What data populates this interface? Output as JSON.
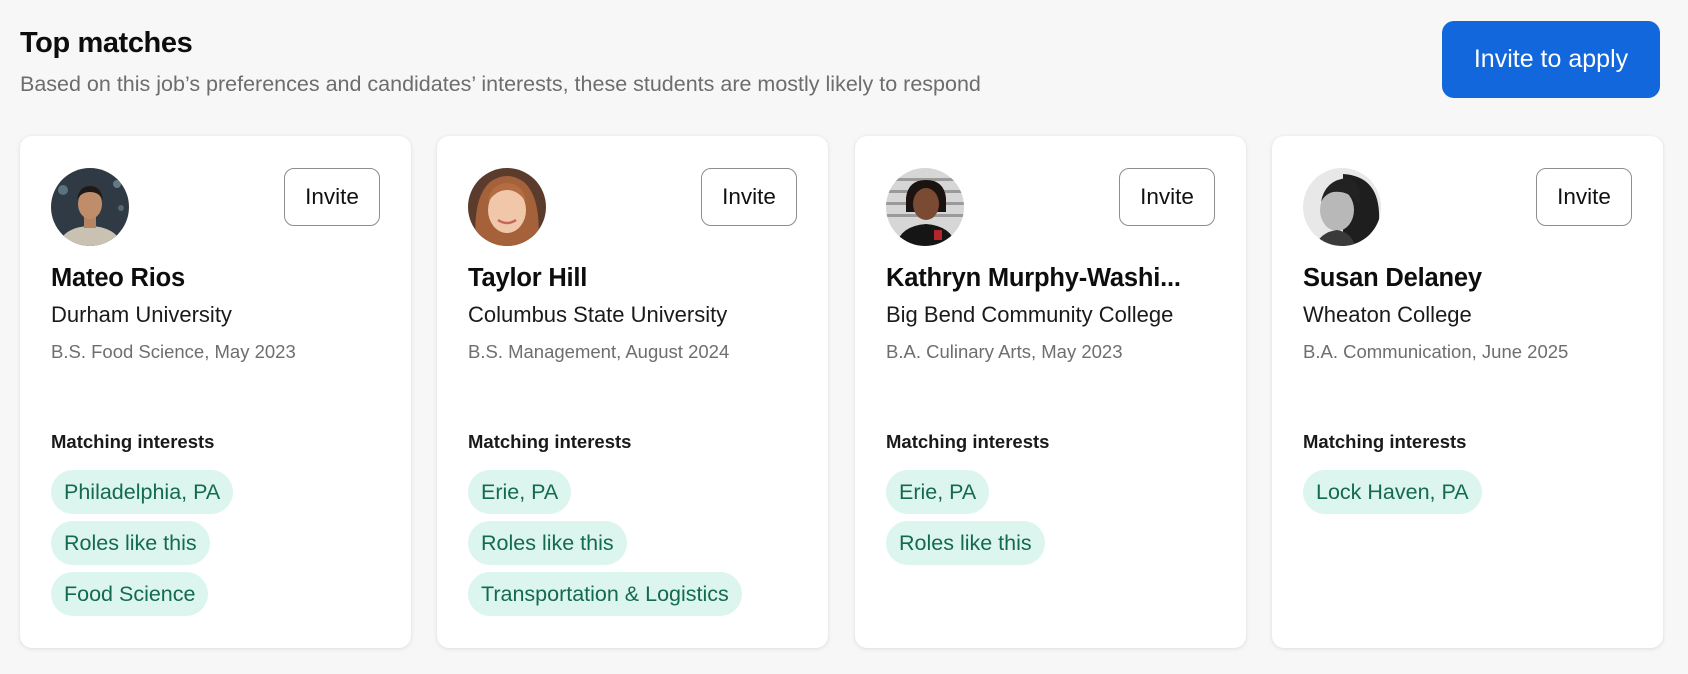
{
  "header": {
    "title": "Top matches",
    "subtitle": "Based on this job’s preferences and candidates’ interests, these students are mostly likely to respond",
    "invite_to_apply_label": "Invite to apply"
  },
  "interests_label": "Matching interests",
  "cards": [
    {
      "name": "Mateo Rios",
      "school": "Durham University",
      "degree": "B.S. Food Science, May 2023",
      "invite_label": "Invite",
      "interests": [
        "Philadelphia, PA",
        "Roles like this",
        "Food Science"
      ]
    },
    {
      "name": "Taylor Hill",
      "school": "Columbus State University",
      "degree": "B.S. Management, August 2024",
      "invite_label": "Invite",
      "interests": [
        "Erie, PA",
        "Roles like this",
        "Transportation & Logistics"
      ]
    },
    {
      "name": "Kathryn Murphy-Washi...",
      "school": "Big Bend Community College",
      "degree": "B.A. Culinary Arts, May 2023",
      "invite_label": "Invite",
      "interests": [
        "Erie, PA",
        "Roles like this"
      ]
    },
    {
      "name": "Susan Delaney",
      "school": "Wheaton College",
      "degree": "B.A. Communication, June 2025",
      "invite_label": "Invite",
      "interests": [
        "Lock Haven, PA"
      ]
    }
  ],
  "colors": {
    "primary": "#1167db",
    "chip_bg": "#dcf5ee",
    "chip_text": "#146a4f"
  }
}
